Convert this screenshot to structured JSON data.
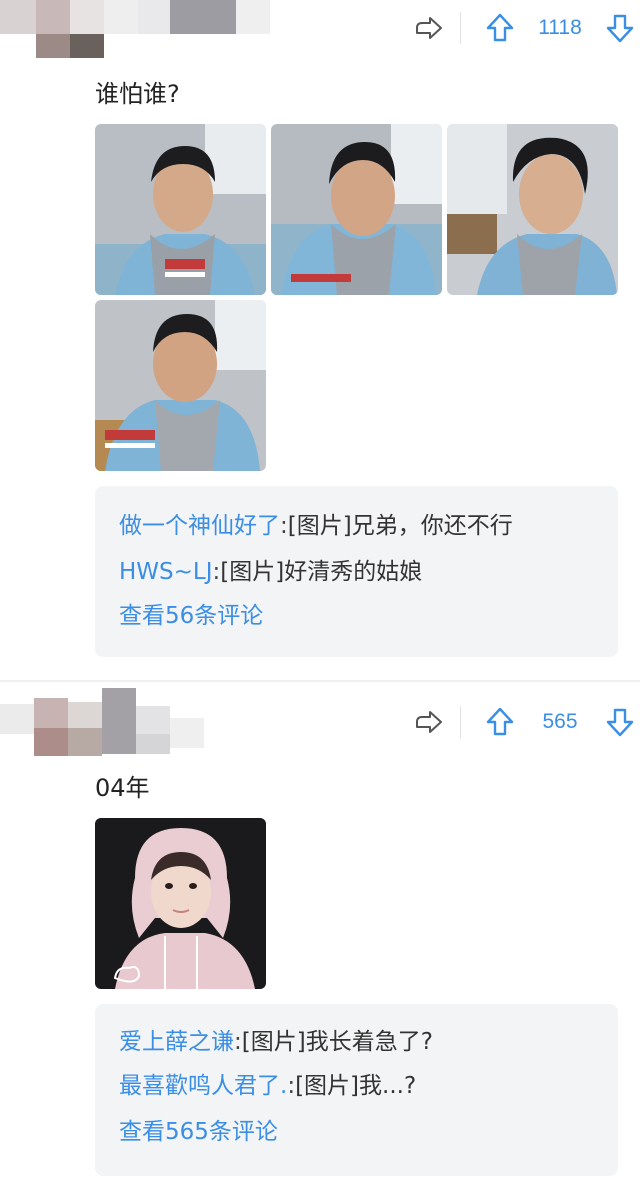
{
  "colors": {
    "accent": "#3a8ee6",
    "text": "#222222",
    "comment_bg": "#f3f4f6",
    "divider": "#f0f0f0"
  },
  "posts": [
    {
      "text": "谁怕谁?",
      "votes": "1118",
      "icons": {
        "share": "share-arrow-icon",
        "upvote": "upvote-arrow-icon",
        "downvote": "downvote-arrow-icon"
      },
      "images": [
        {
          "alt": "photo-1"
        },
        {
          "alt": "photo-2"
        },
        {
          "alt": "photo-3"
        },
        {
          "alt": "photo-4"
        }
      ],
      "comments": [
        {
          "user": "做一个神仙好了",
          "sep": ":",
          "text": "[图片]兄弟，你还不行"
        },
        {
          "user": "HWS~LJ",
          "sep": ":",
          "text": "[图片]好清秀的姑娘"
        }
      ],
      "more": "查看56条评论"
    },
    {
      "text": "04年",
      "votes": "565",
      "icons": {
        "share": "share-arrow-icon",
        "upvote": "upvote-arrow-icon",
        "downvote": "downvote-arrow-icon"
      },
      "images": [
        {
          "alt": "photo-1"
        }
      ],
      "comments": [
        {
          "user": "爱上薛之谦",
          "sep": ":",
          "text": "[图片]我长着急了?"
        },
        {
          "user": "最喜歡鸣人君了.",
          "sep": ":",
          "text": "[图片]我...?"
        }
      ],
      "more": "查看565条评论"
    }
  ]
}
